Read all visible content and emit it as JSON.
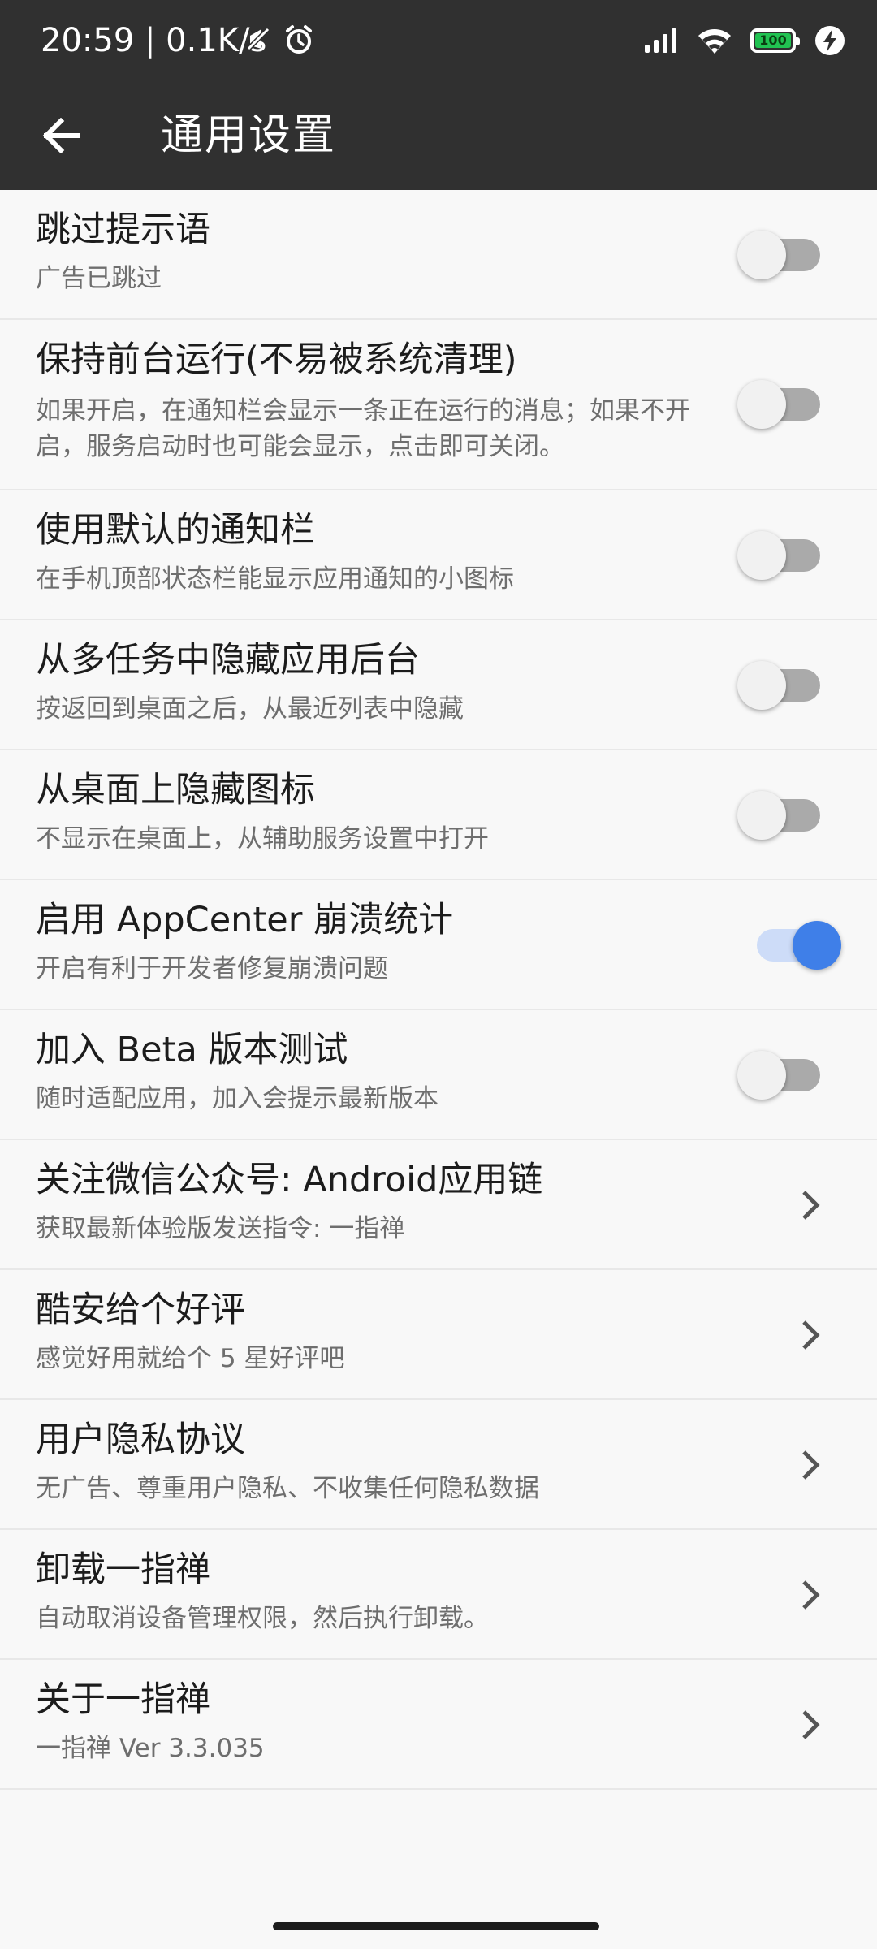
{
  "status_bar": {
    "time_speed": "20:59 | 0.1K/s",
    "icons": [
      "mute-icon",
      "alarm-icon",
      "signal-icon",
      "wifi-icon",
      "battery-icon",
      "charging-icon"
    ],
    "battery_level": "100",
    "battery_color": "#21c352"
  },
  "app_bar": {
    "back_icon": "arrow-left-icon",
    "title": "通用设置",
    "background": "#303030"
  },
  "settings": [
    {
      "label": "跳过提示语",
      "desc": "广告已跳过",
      "control": "switch",
      "on": false
    },
    {
      "label": "保持前台运行(不易被系统清理)",
      "desc": "如果开启，在通知栏会显示一条正在运行的消息；如果不开启，服务启动时也可能会显示，点击即可关闭。",
      "control": "switch",
      "on": false
    },
    {
      "label": "使用默认的通知栏",
      "desc": "在手机顶部状态栏能显示应用通知的小图标",
      "control": "switch",
      "on": false
    },
    {
      "label": "从多任务中隐藏应用后台",
      "desc": "按返回到桌面之后，从最近列表中隐藏",
      "control": "switch",
      "on": false
    },
    {
      "label": "从桌面上隐藏图标",
      "desc": "不显示在桌面上，从辅助服务设置中打开",
      "control": "switch",
      "on": false
    },
    {
      "label": "启用 AppCenter 崩溃统计",
      "desc": "开启有利于开发者修复崩溃问题",
      "control": "switch",
      "on": true
    },
    {
      "label": "加入 Beta 版本测试",
      "desc": "随时适配应用，加入会提示最新版本",
      "control": "switch",
      "on": false
    },
    {
      "label": "关注微信公众号: Android应用链",
      "desc": "获取最新体验版发送指令: 一指禅",
      "control": "chevron"
    },
    {
      "label": "酷安给个好评",
      "desc": "感觉好用就给个 5 星好评吧",
      "control": "chevron"
    },
    {
      "label": "用户隐私协议",
      "desc": "无广告、尊重用户隐私、不收集任何隐私数据",
      "control": "chevron"
    },
    {
      "label": "卸载一指禅",
      "desc": "自动取消设备管理权限，然后执行卸载。",
      "control": "chevron"
    },
    {
      "label": "关于一指禅",
      "desc": "一指禅 Ver 3.3.035",
      "control": "chevron"
    }
  ],
  "colors": {
    "switch_on": "#3f7fe8",
    "switch_off_track": "#aaaaaa",
    "background": "#f8f8f8"
  }
}
